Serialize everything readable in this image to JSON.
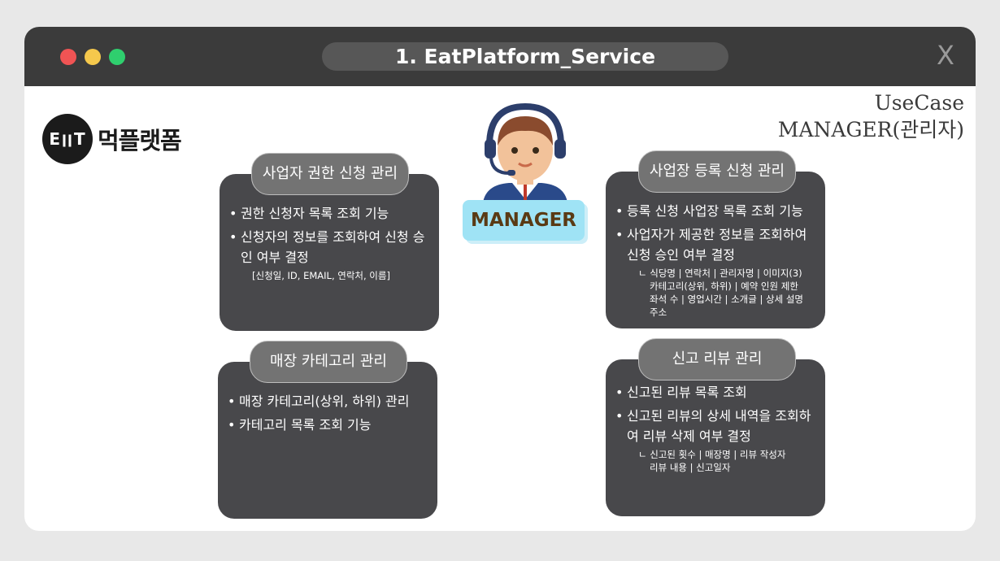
{
  "window": {
    "title": "1. EatPlatform_Service",
    "close_label": "X"
  },
  "header": {
    "usecase_line1": "UseCase",
    "usecase_line2": "MANAGER(관리자)"
  },
  "logo": {
    "mark": "E🍴T",
    "text": "먹플랫폼"
  },
  "actor": {
    "label": "MANAGER"
  },
  "cards": {
    "permission": {
      "title": "사업자 권한 신청 관리",
      "items": [
        "권한 신청자 목록 조회 기능",
        "신청자의 정보를 조회하여 신청 승인 여부 결정"
      ],
      "note": "[신청일, ID, EMAIL, 연락처, 이름]"
    },
    "category": {
      "title": "매장 카테고리 관리",
      "items": [
        "매장 카테고리(상위, 하위) 관리",
        "카테고리 목록 조회 기능"
      ]
    },
    "store": {
      "title": "사업장 등록 신청 관리",
      "items": [
        "등록 신청 사업장 목록 조회 기능",
        "사업자가 제공한 정보를 조회하여 신청 승인 여부 결정"
      ],
      "notes": [
        "ㄴ 식당명 | 연락처 | 관리자명 | 이미지(3)",
        "카테고리(상위, 하위) | 예약 인원 제한",
        "좌석 수 | 영업시간 | 소개글 | 상세 설명",
        "주소"
      ]
    },
    "review": {
      "title": "신고 리뷰 관리",
      "items": [
        "신고된 리뷰 목록 조회",
        "신고된 리뷰의 상세 내역을 조회하여 리뷰 삭제 여부 결정"
      ],
      "notes": [
        "ㄴ 신고된 횟수 | 매장명 | 리뷰 작성자",
        "리뷰 내용 | 신고일자"
      ]
    }
  },
  "colors": {
    "titlebar": "#3b3b3b",
    "card": "#48484b",
    "card_title": "#737373",
    "badge": "#9fe3f5"
  }
}
